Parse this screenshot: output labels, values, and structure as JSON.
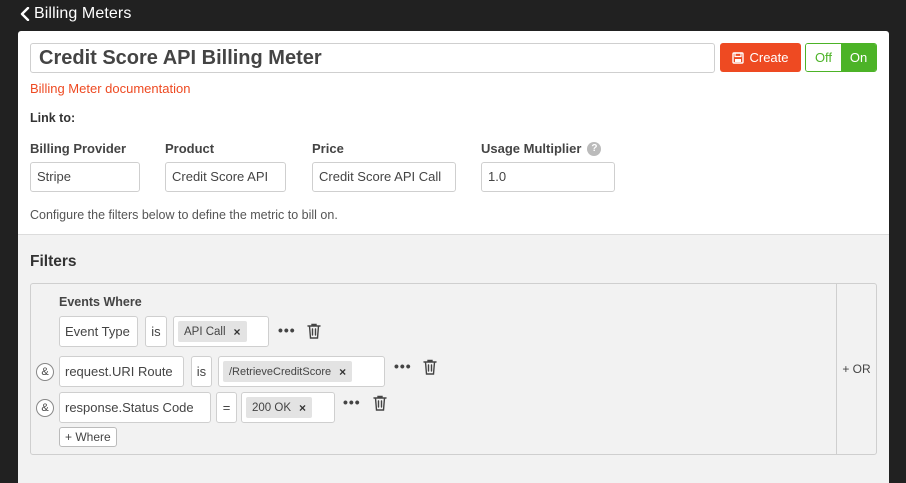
{
  "header": {
    "back_label": "Billing Meters"
  },
  "meter": {
    "name": "Credit Score API Billing Meter",
    "create_label": "Create",
    "toggle_off": "Off",
    "toggle_on": "On",
    "doc_link": "Billing Meter documentation",
    "link_to_label": "Link to:"
  },
  "fields": {
    "provider_label": "Billing Provider",
    "provider_value": "Stripe",
    "product_label": "Product",
    "product_value": "Credit Score API",
    "price_label": "Price",
    "price_value": "Credit Score API Call",
    "multiplier_label": "Usage Multiplier",
    "multiplier_value": "1.0"
  },
  "help_text": "Configure the filters below to define the metric to bill on.",
  "filters": {
    "title": "Filters",
    "events_where": "Events Where",
    "or_label": "+ OR",
    "add_where": "+ Where",
    "and_symbol": "&",
    "rows": [
      {
        "field": "Event Type",
        "operator": "is",
        "value": "API Call"
      },
      {
        "field": "request.URI Route",
        "operator": "is",
        "value": "/RetrieveCreditScore"
      },
      {
        "field": "response.Status Code",
        "operator": "=",
        "value": "200 OK"
      }
    ],
    "more_glyph": "•••",
    "remove_glyph": "×"
  },
  "icons": {
    "back": "chevron-left-icon",
    "save": "save-icon",
    "help": "question-icon",
    "trash": "trash-icon"
  },
  "colors": {
    "accent": "#ee4a22",
    "on_green": "#4cb327"
  }
}
